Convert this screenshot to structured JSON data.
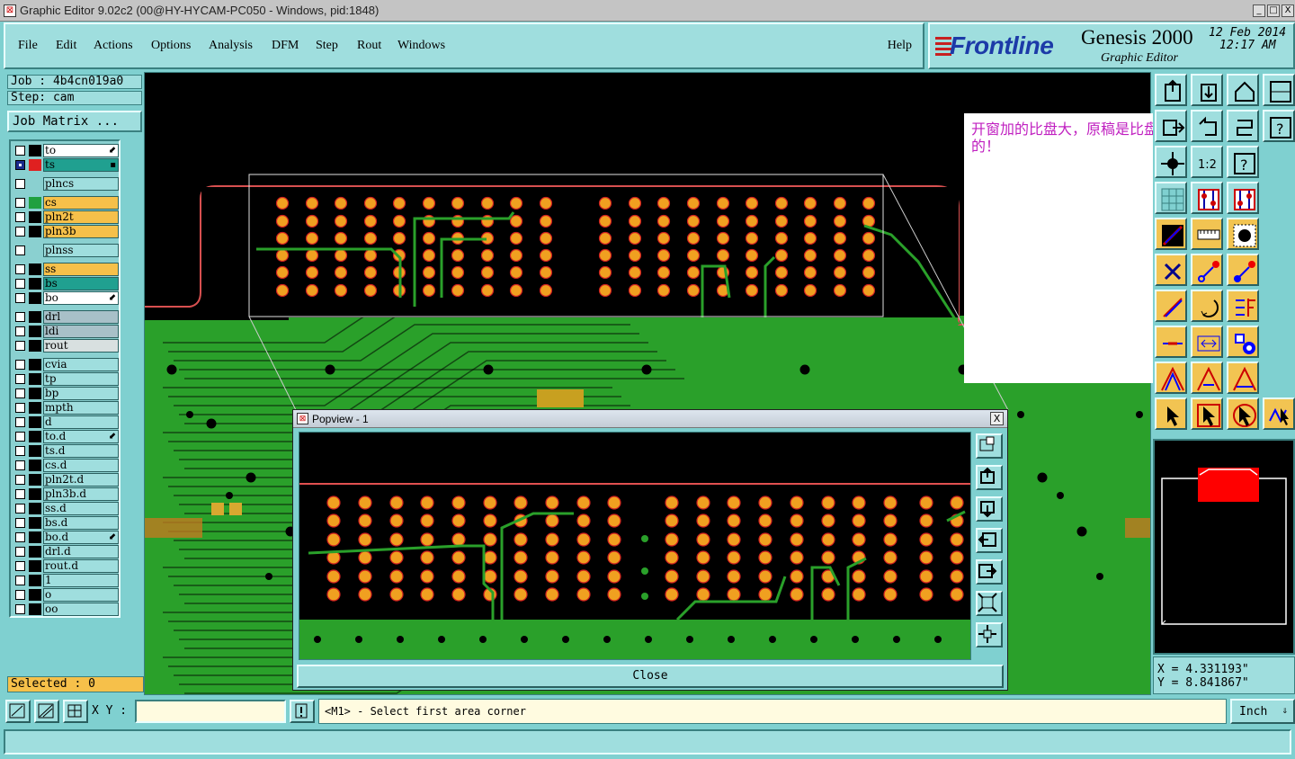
{
  "window": {
    "title": "Graphic Editor 9.02c2 (00@HY-HYCAM-PC050 - Windows, pid:1848)",
    "controls": [
      "_",
      "□",
      "X"
    ]
  },
  "menu": {
    "items": [
      "File",
      "Edit",
      "Actions",
      "Options",
      "Analysis",
      "DFM",
      "Step",
      "Rout",
      "Windows"
    ],
    "help": "Help"
  },
  "logo": {
    "brand": "Frontline",
    "product": "Genesis 2000",
    "subtitle": "Graphic Editor",
    "date": "12 Feb 2014",
    "time": "12:17 AM"
  },
  "job": {
    "job_label": "Job : 4b4cn019a0",
    "step_label": "Step: cam",
    "matrix_button": "Job Matrix ..."
  },
  "layers": [
    {
      "name": "to",
      "color": "#ffffff",
      "swatch": "#000000",
      "checked": false,
      "mark": "⬋"
    },
    {
      "name": "ts",
      "color": "#20a090",
      "swatch": "#e02020",
      "checked": true,
      "mark": "▪"
    },
    {
      "name": "plncs",
      "color": "#9fdede",
      "swatch": "",
      "checked": false,
      "mark": ""
    },
    {
      "name": "cs",
      "color": "#f6c04a",
      "swatch": "#20a040",
      "checked": false,
      "mark": ""
    },
    {
      "name": "pln2t",
      "color": "#f6c04a",
      "swatch": "#000000",
      "checked": false,
      "mark": ""
    },
    {
      "name": "pln3b",
      "color": "#f6c04a",
      "swatch": "#000000",
      "checked": false,
      "mark": ""
    },
    {
      "name": "plnss",
      "color": "#9fdede",
      "swatch": "",
      "checked": false,
      "mark": ""
    },
    {
      "name": "ss",
      "color": "#f6c04a",
      "swatch": "#000000",
      "checked": false,
      "mark": ""
    },
    {
      "name": "bs",
      "color": "#20a090",
      "swatch": "#000000",
      "checked": false,
      "mark": ""
    },
    {
      "name": "bo",
      "color": "#ffffff",
      "swatch": "#000000",
      "checked": false,
      "mark": "⬋"
    },
    {
      "name": "drl",
      "color": "#a8c0c8",
      "swatch": "#000000",
      "checked": false,
      "mark": ""
    },
    {
      "name": "ldi",
      "color": "#a8c0c8",
      "swatch": "#000000",
      "checked": false,
      "mark": ""
    },
    {
      "name": "rout",
      "color": "#d8e0e0",
      "swatch": "#000000",
      "checked": false,
      "mark": ""
    },
    {
      "name": "cvia",
      "color": "#9fdede",
      "swatch": "#000000",
      "checked": false,
      "mark": ""
    },
    {
      "name": "tp",
      "color": "#9fdede",
      "swatch": "#000000",
      "checked": false,
      "mark": ""
    },
    {
      "name": "bp",
      "color": "#9fdede",
      "swatch": "#000000",
      "checked": false,
      "mark": ""
    },
    {
      "name": "mpth",
      "color": "#9fdede",
      "swatch": "#000000",
      "checked": false,
      "mark": ""
    },
    {
      "name": "d",
      "color": "#9fdede",
      "swatch": "#000000",
      "checked": false,
      "mark": ""
    },
    {
      "name": "to.d",
      "color": "#9fdede",
      "swatch": "#000000",
      "checked": false,
      "mark": "⬋"
    },
    {
      "name": "ts.d",
      "color": "#9fdede",
      "swatch": "#000000",
      "checked": false,
      "mark": ""
    },
    {
      "name": "cs.d",
      "color": "#9fdede",
      "swatch": "#000000",
      "checked": false,
      "mark": ""
    },
    {
      "name": "pln2t.d",
      "color": "#9fdede",
      "swatch": "#000000",
      "checked": false,
      "mark": ""
    },
    {
      "name": "pln3b.d",
      "color": "#9fdede",
      "swatch": "#000000",
      "checked": false,
      "mark": ""
    },
    {
      "name": "ss.d",
      "color": "#9fdede",
      "swatch": "#000000",
      "checked": false,
      "mark": ""
    },
    {
      "name": "bs.d",
      "color": "#9fdede",
      "swatch": "#000000",
      "checked": false,
      "mark": ""
    },
    {
      "name": "bo.d",
      "color": "#9fdede",
      "swatch": "#000000",
      "checked": false,
      "mark": "⬋"
    },
    {
      "name": "drl.d",
      "color": "#9fdede",
      "swatch": "#000000",
      "checked": false,
      "mark": ""
    },
    {
      "name": "rout.d",
      "color": "#9fdede",
      "swatch": "#000000",
      "checked": false,
      "mark": ""
    },
    {
      "name": "1",
      "color": "#9fdede",
      "swatch": "#000000",
      "checked": false,
      "mark": ""
    },
    {
      "name": "o",
      "color": "#9fdede",
      "swatch": "#000000",
      "checked": false,
      "mark": ""
    },
    {
      "name": "oo",
      "color": "#9fdede",
      "swatch": "#000000",
      "checked": false,
      "mark": ""
    }
  ],
  "selected": "Selected : 0",
  "note": "开窗加的比盘大，原稿是比盘小的！",
  "coords": {
    "x": "X = 4.331193\"",
    "y": "Y = 8.841867\""
  },
  "bottom": {
    "xy_label": "X Y :",
    "xy_value": "",
    "message": "<M1> - Select first area corner",
    "unit": "Inch"
  },
  "popview": {
    "title": "Popview - 1",
    "close_button": "Close",
    "close_x": "X"
  },
  "tools": [
    "page-up-icon",
    "page-down-icon",
    "home-icon",
    "zoom-window-icon",
    "exit-icon",
    "undo-icon",
    "redo-icon",
    "help-icon",
    "pan-icon",
    "ratio-icon",
    "question-icon",
    "",
    "grid-icon",
    "layer-up-icon",
    "layer-down-icon",
    "",
    "draw-icon",
    "ruler-icon",
    "pad-icon",
    "",
    "cross-icon",
    "move-icon",
    "connect-icon",
    "",
    "line-icon",
    "arc-icon",
    "measure-icon",
    "",
    "minus-icon",
    "snap-icon",
    "shapes-icon",
    "",
    "triangle-icon",
    "triangle-up-icon",
    "triangle-arrow-icon",
    "",
    "pointer-icon",
    "pointer-select-icon",
    "pointer-move-icon",
    "pointer-edit-icon"
  ],
  "colors": {
    "board": "#2aa02a",
    "pad": "#f0a020",
    "pad_ring": "#d02020",
    "canvas_bg": "#000000"
  }
}
